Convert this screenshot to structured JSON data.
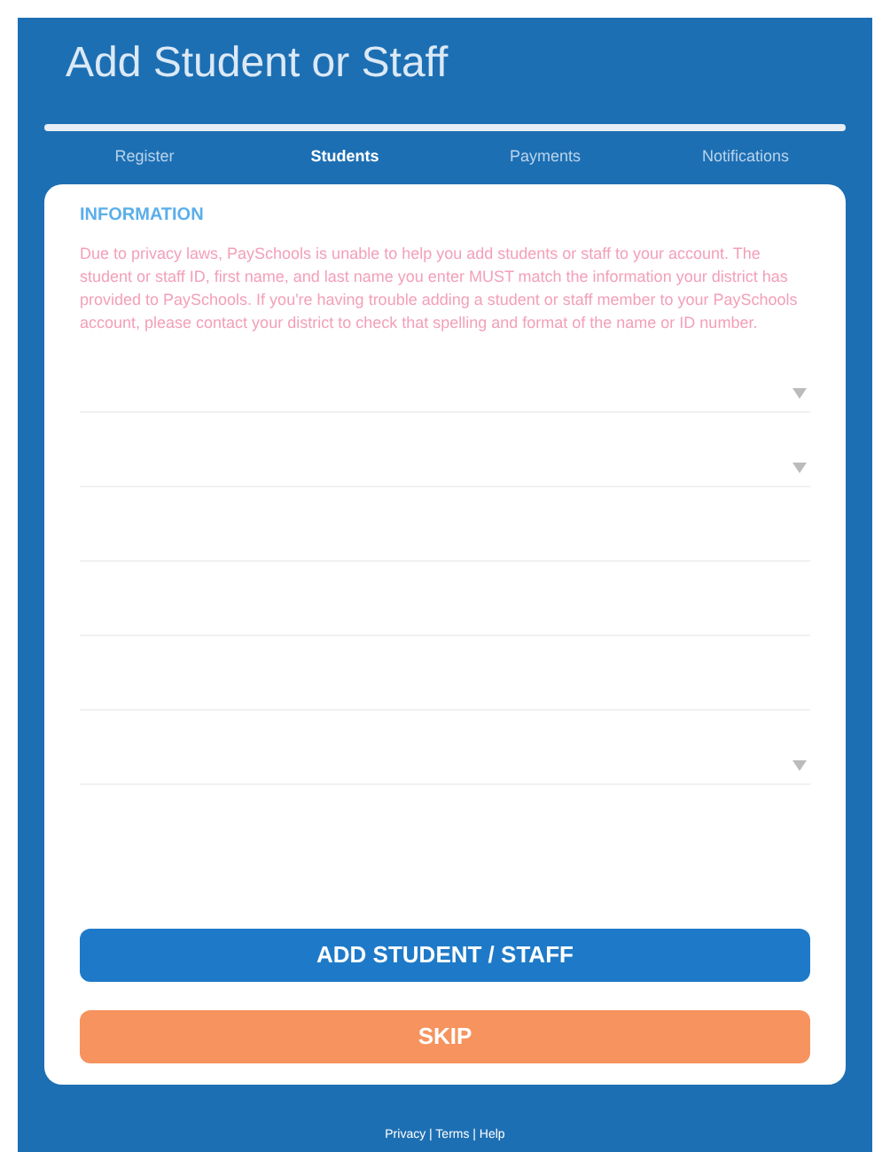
{
  "title": "Add Student or Staff",
  "tabs": [
    {
      "label": "Register",
      "selected": false
    },
    {
      "label": "Students",
      "selected": true
    },
    {
      "label": "Payments",
      "selected": false
    },
    {
      "label": "Notifications",
      "selected": false
    }
  ],
  "info": {
    "heading": "INFORMATION",
    "text": "Due to privacy laws, PaySchools is unable to help you add students or staff to your account. The student or staff ID, first name, and last name you enter MUST match the information your district has provided to PaySchools. If you're having trouble adding a student or staff member to your PaySchools account, please contact your district to check that spelling and format of the name or ID number."
  },
  "fields": [
    {
      "kind": "select"
    },
    {
      "kind": "select"
    },
    {
      "kind": "input"
    },
    {
      "kind": "input"
    },
    {
      "kind": "input"
    },
    {
      "kind": "select"
    }
  ],
  "buttons": [
    {
      "label": "ADD STUDENT / STAFF",
      "kind": "primary"
    },
    {
      "label": "SKIP",
      "kind": "secondary"
    }
  ],
  "footer": "Privacy | Terms | Help"
}
